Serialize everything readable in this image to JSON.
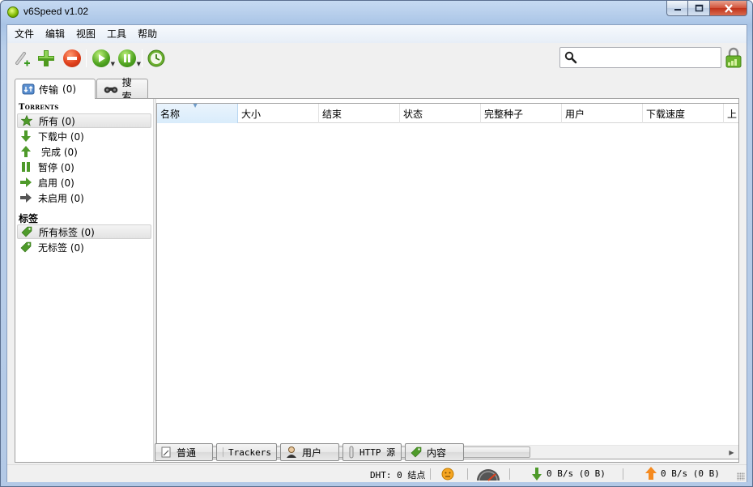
{
  "window": {
    "title": "v6Speed v1.02"
  },
  "menu": [
    "文件",
    "编辑",
    "视图",
    "工具",
    "帮助"
  ],
  "toolbar": {
    "buttons": [
      "add-link-icon",
      "add-torrent-icon",
      "remove-icon",
      "start-icon",
      "pause-icon",
      "preferences-icon"
    ],
    "search_placeholder": ""
  },
  "tabs": [
    {
      "label": "传输",
      "count": "(0)"
    },
    {
      "label": "搜索"
    }
  ],
  "sidebar": {
    "torrents_header": "Torrents",
    "torrents": [
      {
        "label": "所有 (0)",
        "icon": "star-icon"
      },
      {
        "label": "下载中 (0)",
        "icon": "arrow-down-icon"
      },
      {
        "label": "完成 (0)",
        "icon": "arrow-up-icon"
      },
      {
        "label": "暂停 (0)",
        "icon": "pause-icon"
      },
      {
        "label": "启用 (0)",
        "icon": "arrow-right-icon"
      },
      {
        "label": "未启用 (0)",
        "icon": "arrow-right-gray-icon"
      }
    ],
    "labels_header": "标签",
    "labels": [
      {
        "label": "所有标签 (0)",
        "icon": "tag-icon"
      },
      {
        "label": "无标签 (0)",
        "icon": "tag-icon"
      }
    ]
  },
  "columns": [
    "名称",
    "大小",
    "结束",
    "状态",
    "完整种子",
    "用户",
    "下载速度",
    "上"
  ],
  "detail_tabs": [
    "普通",
    "Trackers",
    "用户",
    "HTTP 源",
    "内容"
  ],
  "status": {
    "dht": "DHT: 0 结点",
    "down": "0 B/s (0 B)",
    "up": "0 B/s (0 B)"
  },
  "colors": {
    "green": "#5aa02c",
    "red": "#d83a1e",
    "accent": "#3c7fc1"
  }
}
